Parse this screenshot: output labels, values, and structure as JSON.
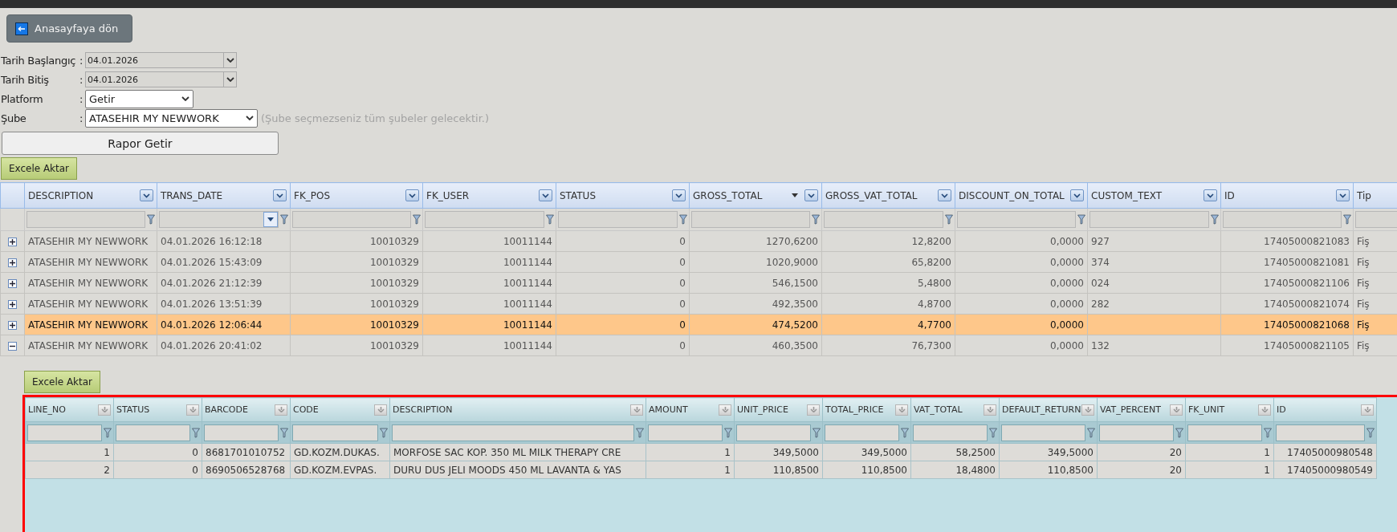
{
  "back_button": {
    "label": "Anasayfaya dön"
  },
  "form": {
    "fields": [
      {
        "label": "Tarih Başlangıç",
        "separator": ":",
        "kind": "date",
        "value": "04.01.2026"
      },
      {
        "label": "Tarih Bitiş",
        "separator": ":",
        "kind": "date",
        "value": "04.01.2026"
      },
      {
        "label": "Platform",
        "separator": ":",
        "kind": "select",
        "value": "Getir"
      },
      {
        "label": "Şube",
        "separator": ":",
        "kind": "select",
        "value": "ATASEHIR MY NEWWORK",
        "note": "(Şube seçmezseniz tüm şubeler gelecektir.)"
      }
    ],
    "submit": "Rapor Getir"
  },
  "export_button": "Excele Aktar",
  "grid": {
    "columns": [
      {
        "label": "DESCRIPTION",
        "numeric": false,
        "date_filter": false,
        "sort_desc": false
      },
      {
        "label": "TRANS_DATE",
        "numeric": false,
        "date_filter": true,
        "sort_desc": false
      },
      {
        "label": "FK_POS",
        "numeric": true,
        "date_filter": false,
        "sort_desc": false
      },
      {
        "label": "FK_USER",
        "numeric": true,
        "date_filter": false,
        "sort_desc": false
      },
      {
        "label": "STATUS",
        "numeric": true,
        "date_filter": false,
        "sort_desc": false
      },
      {
        "label": "GROSS_TOTAL",
        "numeric": true,
        "date_filter": false,
        "sort_desc": true
      },
      {
        "label": "GROSS_VAT_TOTAL",
        "numeric": true,
        "date_filter": false,
        "sort_desc": false
      },
      {
        "label": "DISCOUNT_ON_TOTAL",
        "numeric": true,
        "date_filter": false,
        "sort_desc": false
      },
      {
        "label": "CUSTOM_TEXT",
        "numeric": false,
        "date_filter": false,
        "sort_desc": false
      },
      {
        "label": "ID",
        "numeric": true,
        "date_filter": false,
        "sort_desc": false
      },
      {
        "label": "Tip",
        "numeric": false,
        "date_filter": false,
        "sort_desc": false
      }
    ],
    "rows": [
      {
        "expanded": false,
        "selected": false,
        "cells": [
          "ATASEHIR MY NEWWORK",
          "04.01.2026 16:12:18",
          "10010329",
          "10011144",
          "0",
          "1270,6200",
          "12,8200",
          "0,0000",
          "927",
          "17405000821083",
          "Fiş"
        ]
      },
      {
        "expanded": false,
        "selected": false,
        "cells": [
          "ATASEHIR MY NEWWORK",
          "04.01.2026 15:43:09",
          "10010329",
          "10011144",
          "0",
          "1020,9000",
          "65,8200",
          "0,0000",
          "374",
          "17405000821081",
          "Fiş"
        ]
      },
      {
        "expanded": false,
        "selected": false,
        "cells": [
          "ATASEHIR MY NEWWORK",
          "04.01.2026 21:12:39",
          "10010329",
          "10011144",
          "0",
          "546,1500",
          "5,4800",
          "0,0000",
          "024",
          "17405000821106",
          "Fiş"
        ]
      },
      {
        "expanded": false,
        "selected": false,
        "cells": [
          "ATASEHIR MY NEWWORK",
          "04.01.2026 13:51:39",
          "10010329",
          "10011144",
          "0",
          "492,3500",
          "4,8700",
          "0,0000",
          "282",
          "17405000821074",
          "Fiş"
        ]
      },
      {
        "expanded": false,
        "selected": true,
        "cells": [
          "ATASEHIR MY NEWWORK",
          "04.01.2026 12:06:44",
          "10010329",
          "10011144",
          "0",
          "474,5200",
          "4,7700",
          "0,0000",
          "",
          "17405000821068",
          "Fiş"
        ]
      },
      {
        "expanded": true,
        "selected": false,
        "cells": [
          "ATASEHIR MY NEWWORK",
          "04.01.2026 20:41:02",
          "10010329",
          "10011144",
          "0",
          "460,3500",
          "76,7300",
          "0,0000",
          "132",
          "17405000821105",
          "Fiş"
        ]
      }
    ]
  },
  "detail": {
    "export_button": "Excele Aktar",
    "columns": [
      {
        "label": "LINE_NO",
        "numeric": true
      },
      {
        "label": "STATUS",
        "numeric": true
      },
      {
        "label": "BARCODE",
        "numeric": false
      },
      {
        "label": "CODE",
        "numeric": false
      },
      {
        "label": "DESCRIPTION",
        "numeric": false
      },
      {
        "label": "AMOUNT",
        "numeric": true
      },
      {
        "label": "UNIT_PRICE",
        "numeric": true
      },
      {
        "label": "TOTAL_PRICE",
        "numeric": true
      },
      {
        "label": "VAT_TOTAL",
        "numeric": true
      },
      {
        "label": "DEFAULT_RETURN",
        "numeric": true
      },
      {
        "label": "VAT_PERCENT",
        "numeric": true
      },
      {
        "label": "FK_UNIT",
        "numeric": true
      },
      {
        "label": "ID",
        "numeric": true
      }
    ],
    "rows": [
      [
        "1",
        "0",
        "8681701010752",
        "GD.KOZM.DUKAS.",
        "MORFOSE SAC KOP. 350 ML MILK THERAPY CRE",
        "1",
        "349,5000",
        "349,5000",
        "58,2500",
        "349,5000",
        "20",
        "1",
        "17405000980548"
      ],
      [
        "2",
        "0",
        "8690506528768",
        "GD.KOZM.EVPAS.",
        "DURU DUS JELI MOODS 450 ML LAVANTA & YAS",
        "1",
        "110,8500",
        "110,8500",
        "18,4800",
        "110,8500",
        "20",
        "1",
        "17405000980549"
      ]
    ]
  }
}
